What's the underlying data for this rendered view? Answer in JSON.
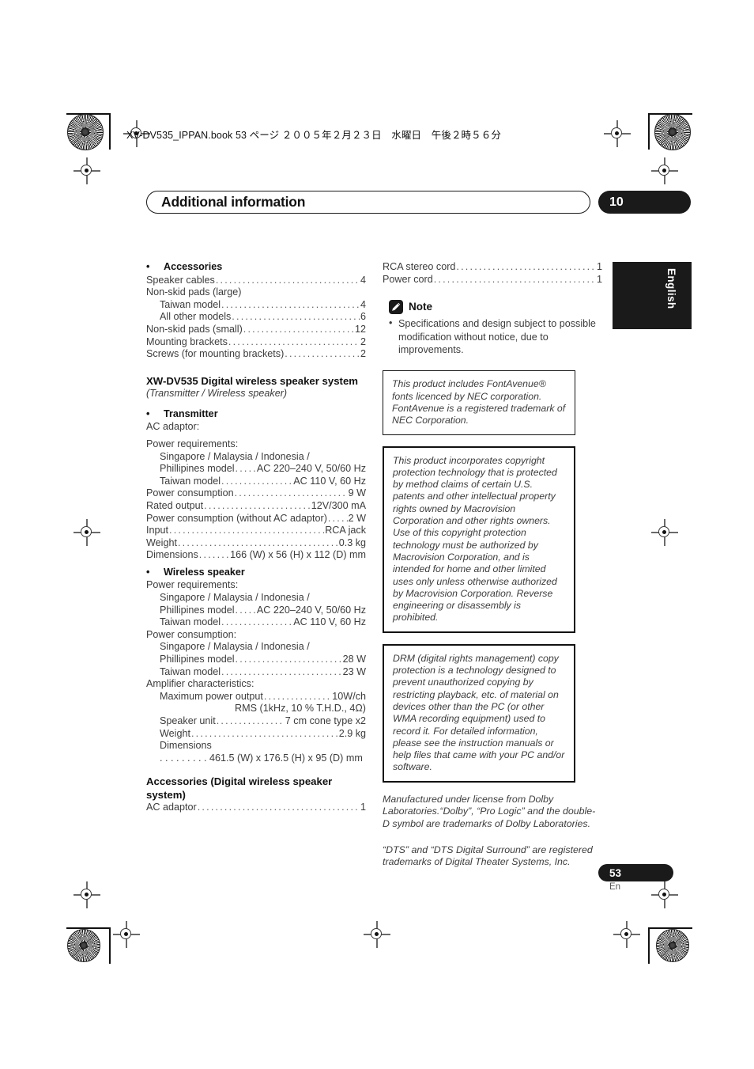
{
  "header": {
    "book_line": "XV-DV535_IPPAN.book 53 ページ ２００５年２月２３日　水曜日　午後２時５６分"
  },
  "title_bar": {
    "title": "Additional information",
    "chapter_number": "10"
  },
  "language_tab": {
    "label": "English"
  },
  "left_column": {
    "accessories_heading": "Accessories",
    "accessories_rows": [
      {
        "label": "Speaker cables",
        "value": "4",
        "indent": 0,
        "leader": true
      },
      {
        "label": "Non-skid pads (large)",
        "value": "",
        "indent": 0,
        "leader": false
      },
      {
        "label": "Taiwan model",
        "value": "4",
        "indent": 1,
        "leader": true
      },
      {
        "label": "All other models",
        "value": "6",
        "indent": 1,
        "leader": true
      },
      {
        "label": "Non-skid pads (small)",
        "value": "12",
        "indent": 0,
        "leader": true
      },
      {
        "label": "Mounting brackets",
        "value": "2",
        "indent": 0,
        "leader": true
      },
      {
        "label": "Screws (for mounting brackets)",
        "value": "2",
        "indent": 0,
        "leader": true
      }
    ],
    "system_heading": "XW-DV535 Digital wireless speaker system",
    "system_subtitle": "(Transmitter / Wireless speaker)",
    "transmitter_heading": "Transmitter",
    "transmitter_rows": [
      {
        "label": "AC adaptor:",
        "value": "",
        "indent": 0,
        "leader": false
      },
      {
        "label": "",
        "value": "",
        "indent": 0,
        "leader": false,
        "spacer": true
      },
      {
        "label": "Power requirements:",
        "value": "",
        "indent": 0,
        "leader": false
      },
      {
        "label": "Singapore / Malaysia / Indonesia /",
        "value": "",
        "indent": 1,
        "leader": false
      },
      {
        "label": "Phillipines model",
        "value": "AC 220–240 V, 50/60 Hz",
        "indent": 1,
        "leader": true
      },
      {
        "label": "Taiwan model",
        "value": "AC 110 V, 60 Hz",
        "indent": 1,
        "leader": true
      },
      {
        "label": "Power consumption",
        "value": "9 W",
        "indent": 0,
        "leader": true
      },
      {
        "label": "Rated output",
        "value": "12V/300 mA",
        "indent": 0,
        "leader": true
      },
      {
        "label": "Power consumption (without AC adaptor)",
        "value": "2 W",
        "indent": 0,
        "leader": true
      },
      {
        "label": "Input",
        "value": "RCA jack",
        "indent": 0,
        "leader": true
      },
      {
        "label": "Weight",
        "value": "0.3 kg",
        "indent": 0,
        "leader": true
      },
      {
        "label": "Dimensions",
        "value": "166 (W) x 56 (H) x 112 (D) mm",
        "indent": 0,
        "leader": true
      }
    ],
    "wireless_heading": "Wireless speaker",
    "wireless_rows": [
      {
        "label": "Power requirements:",
        "value": "",
        "indent": 0,
        "leader": false
      },
      {
        "label": "Singapore / Malaysia / Indonesia /",
        "value": "",
        "indent": 1,
        "leader": false
      },
      {
        "label": "Phillipines model",
        "value": "AC 220–240 V, 50/60 Hz",
        "indent": 1,
        "leader": true
      },
      {
        "label": "Taiwan model",
        "value": "AC 110 V, 60 Hz",
        "indent": 1,
        "leader": true
      },
      {
        "label": "Power consumption:",
        "value": "",
        "indent": 0,
        "leader": false
      },
      {
        "label": "Singapore / Malaysia / Indonesia /",
        "value": "",
        "indent": 1,
        "leader": false
      },
      {
        "label": "Phillipines model",
        "value": "28 W",
        "indent": 1,
        "leader": true
      },
      {
        "label": "Taiwan model",
        "value": "23 W",
        "indent": 1,
        "leader": true
      },
      {
        "label": "Amplifier characteristics:",
        "value": "",
        "indent": 0,
        "leader": false
      },
      {
        "label": "Maximum power output",
        "value": "10W/ch",
        "indent": 1,
        "leader": true
      }
    ],
    "rms_line": "RMS (1kHz, 10 % T.H.D., 4Ω)",
    "wireless_rows2": [
      {
        "label": "Speaker unit",
        "value": "7 cm cone type x2",
        "indent": 1,
        "leader": true
      },
      {
        "label": "Weight",
        "value": "2.9 kg",
        "indent": 1,
        "leader": true
      },
      {
        "label": "Dimensions",
        "value": "",
        "indent": 1,
        "leader": false
      }
    ],
    "dimensions_line": ". . . . . . . . .  461.5 (W) x 176.5 (H) x 95 (D) mm",
    "accessories2_heading": "Accessories (Digital wireless speaker system)",
    "accessories2_rows": [
      {
        "label": "AC adaptor",
        "value": "1",
        "indent": 0,
        "leader": true
      }
    ]
  },
  "right_column": {
    "cord_rows": [
      {
        "label": "RCA stereo cord",
        "value": "1",
        "indent": 0,
        "leader": true
      },
      {
        "label": "Power cord",
        "value": "1",
        "indent": 0,
        "leader": true
      }
    ],
    "note_label": "Note",
    "note_icon": "pencil-icon",
    "note_bullet": "•",
    "note_text": "Specifications and design subject to possible modification without notice, due to improvements.",
    "fontavenue_box": "This product includes FontAvenue® fonts licenced by NEC corporation. FontAvenue is a registered trademark of NEC Corporation.",
    "macrovision_box": "This product incorporates copyright protection technology that is protected by method claims of certain U.S. patents and other intellectual property rights owned by Macrovision Corporation and other rights owners. Use of this copyright protection technology must be authorized by Macrovision Corporation, and is intended for home and other limited uses only unless otherwise authorized by Macrovision Corporation. Reverse engineering or disassembly is prohibited.",
    "drm_box": "DRM (digital rights management) copy protection is a technology designed to prevent unauthorized copying by restricting playback, etc. of material on devices other than the PC (or other WMA recording equipment) used to record it. For detailed information, please see the instruction manuals or help files that came with your PC and/or software.",
    "dolby_para": "Manufactured under license from Dolby Laboratories.“Dolby”, “Pro Logic” and the double-D symbol are trademarks of Dolby Laboratories.",
    "dts_para": "“DTS” and “DTS Digital Surround” are registered trademarks of Digital Theater Systems, Inc."
  },
  "footer": {
    "page_number": "53",
    "page_language": "En"
  },
  "colors": {
    "ink": "#1a1a1a",
    "body_text": "#3c3c3c",
    "accent_black": "#1a1a1a"
  }
}
